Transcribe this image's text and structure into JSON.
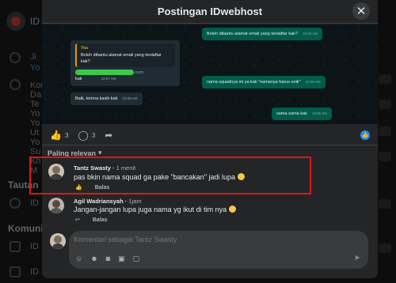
{
  "modal": {
    "title": "Postingan IDwebhost",
    "close_icon": "close-icon"
  },
  "background": {
    "group_prefix": "ID",
    "section1": "Tautan",
    "section2": "Komunit",
    "sidebar_items": [
      "Kor",
      "Da",
      "Te",
      "Yo",
      "Yo",
      "Ut",
      "Yo",
      "Su",
      "Kh",
      "M"
    ],
    "link_prefix": "ID",
    "community_prefixes": [
      "ID",
      "ID"
    ]
  },
  "screenshot": {
    "msg1": "Boleh dibantu alamat email yang terdaftar kak?",
    "msg1_time": "10:36 AM",
    "reply_name": "You",
    "reply_text": "Boleh dibantu alamat email yang terdaftar kak?",
    "msg2_link": ".com",
    "msg2_suffix": "kak",
    "msg2_time": "10:07 AM",
    "msg3": "nama squadnya ini ya kak \"namanya harus unik\"",
    "msg3_time": "10:08 AM",
    "msg4": "Baik, terima kasih kak",
    "msg4_time": "10:09 AM",
    "msg5": "sama-sama kak",
    "msg5_time": "10:09 AM"
  },
  "stats": {
    "likes": "3",
    "comments": "3"
  },
  "sort_label": "Paling relevan",
  "comments": [
    {
      "author": "Tantz Swasty",
      "time": "1 menit",
      "text": "pas bkin nama squad ga pake \"bancakan\" jadi lupa",
      "reply_label": "Balas"
    },
    {
      "author": "Agil Wadriansyah",
      "time": "1jam",
      "text": "Jangan-jangan lupa juga nama yg ikut di tim nya",
      "reply_label": "Balas"
    }
  ],
  "composer": {
    "placeholder": "Komentari sebagai Tantz Swasty"
  }
}
